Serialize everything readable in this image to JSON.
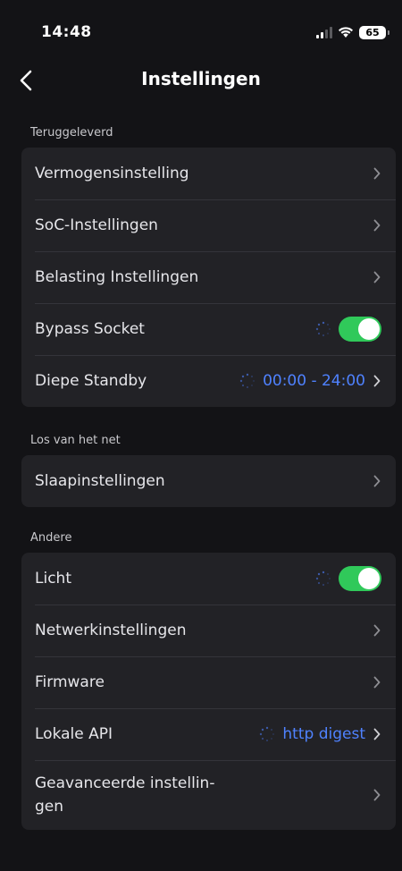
{
  "status_bar": {
    "time": "14:48",
    "battery": "65"
  },
  "nav": {
    "title": "Instellingen"
  },
  "sections": {
    "returned": {
      "label": "Teruggeleverd",
      "items": [
        {
          "label": "Vermogensinstelling"
        },
        {
          "label": "SoC-Instellingen"
        },
        {
          "label": "Belasting Instellingen"
        },
        {
          "label": "Bypass Socket",
          "toggle": true
        },
        {
          "label": "Diepe Standby",
          "value": "00:00 - 24:00"
        }
      ]
    },
    "off_grid": {
      "label": "Los van het net",
      "items": [
        {
          "label": "Slaapinstellingen"
        }
      ]
    },
    "other": {
      "label": "Andere",
      "items": [
        {
          "label": "Licht",
          "toggle": true
        },
        {
          "label": "Netwerkinstellingen"
        },
        {
          "label": "Firmware"
        },
        {
          "label": "Lokale API",
          "value": "http digest"
        },
        {
          "label": "Geavanceerde instellin-\ngen"
        }
      ]
    }
  },
  "colors": {
    "background": "#131316",
    "card": "#222226",
    "accent_blue": "#4f82ff",
    "toggle_on": "#30c95a"
  }
}
